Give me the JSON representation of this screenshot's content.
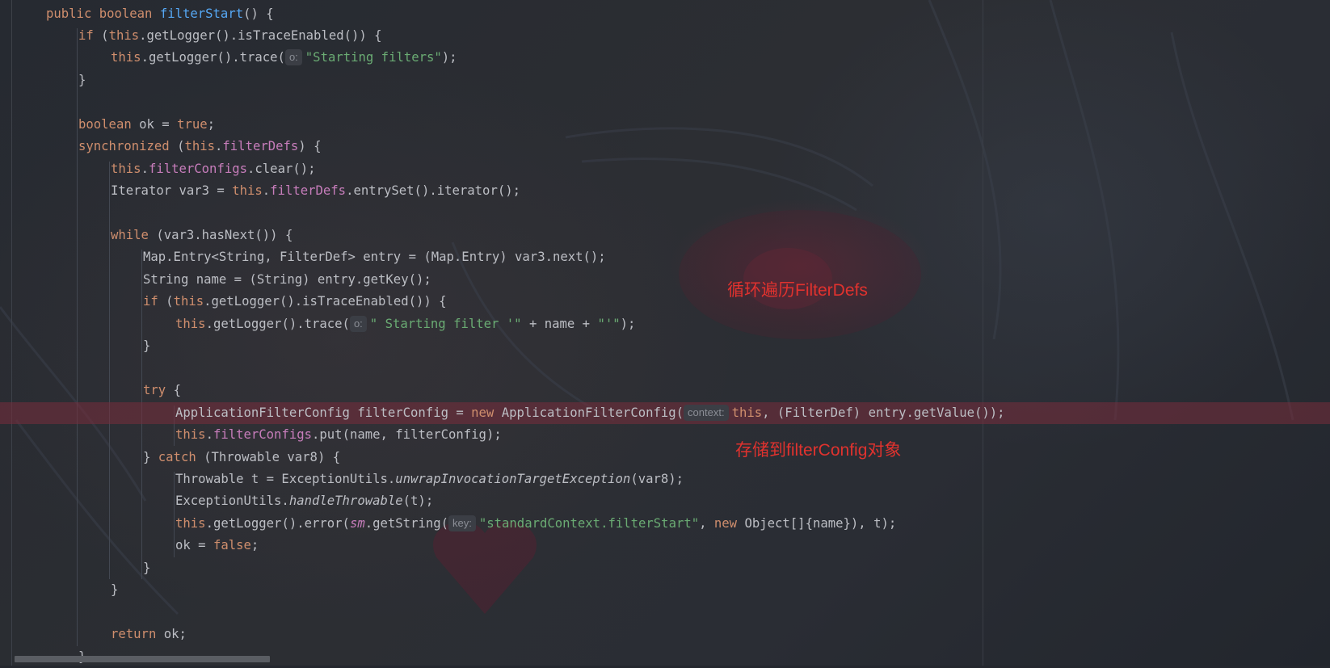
{
  "editor": {
    "lines": [
      {
        "segs": [
          {
            "t": "public boolean ",
            "c": "kw"
          },
          {
            "t": "filterStart",
            "c": "fn"
          },
          {
            "t": "() {",
            "c": ""
          }
        ]
      },
      {
        "segs": [
          {
            "t": "if ",
            "c": "kw"
          },
          {
            "t": "(",
            "c": ""
          },
          {
            "t": "this",
            "c": "kw"
          },
          {
            "t": ".getLogger().isTraceEnabled()) {",
            "c": ""
          }
        ]
      },
      {
        "segs": [
          {
            "t": "this",
            "c": "kw"
          },
          {
            "t": ".getLogger().trace(",
            "c": ""
          },
          {
            "hint": "o:"
          },
          {
            "t": "\"Starting filters\"",
            "c": "str"
          },
          {
            "t": ");",
            "c": ""
          }
        ]
      },
      {
        "segs": [
          {
            "t": "}",
            "c": ""
          }
        ]
      },
      {
        "segs": []
      },
      {
        "segs": [
          {
            "t": "boolean ",
            "c": "kw"
          },
          {
            "t": "ok = ",
            "c": ""
          },
          {
            "t": "true",
            "c": "kw"
          },
          {
            "t": ";",
            "c": ""
          }
        ]
      },
      {
        "segs": [
          {
            "t": "synchronized ",
            "c": "kw"
          },
          {
            "t": "(",
            "c": ""
          },
          {
            "t": "this",
            "c": "kw"
          },
          {
            "t": ".",
            "c": ""
          },
          {
            "t": "filterDefs",
            "c": "fld"
          },
          {
            "t": ") {",
            "c": ""
          }
        ]
      },
      {
        "segs": [
          {
            "t": "this",
            "c": "kw"
          },
          {
            "t": ".",
            "c": ""
          },
          {
            "t": "filterConfigs",
            "c": "fld"
          },
          {
            "t": ".clear();",
            "c": ""
          }
        ]
      },
      {
        "segs": [
          {
            "t": "Iterator var3 = ",
            "c": ""
          },
          {
            "t": "this",
            "c": "kw"
          },
          {
            "t": ".",
            "c": ""
          },
          {
            "t": "filterDefs",
            "c": "fld"
          },
          {
            "t": ".entrySet().iterator();",
            "c": ""
          }
        ]
      },
      {
        "segs": []
      },
      {
        "segs": [
          {
            "t": "while ",
            "c": "kw"
          },
          {
            "t": "(var3.hasNext()) {",
            "c": ""
          }
        ]
      },
      {
        "segs": [
          {
            "t": "Map.Entry<String, FilterDef> entry = (Map.Entry) var3.next();",
            "c": ""
          }
        ]
      },
      {
        "segs": [
          {
            "t": "String name = (String) entry.getKey();",
            "c": ""
          }
        ]
      },
      {
        "segs": [
          {
            "t": "if ",
            "c": "kw"
          },
          {
            "t": "(",
            "c": ""
          },
          {
            "t": "this",
            "c": "kw"
          },
          {
            "t": ".getLogger().isTraceEnabled()) {",
            "c": ""
          }
        ]
      },
      {
        "segs": [
          {
            "t": "this",
            "c": "kw"
          },
          {
            "t": ".getLogger().trace(",
            "c": ""
          },
          {
            "hint": "o:"
          },
          {
            "t": "\" Starting filter '\"",
            "c": "str"
          },
          {
            "t": " + name + ",
            "c": ""
          },
          {
            "t": "\"'\"",
            "c": "str"
          },
          {
            "t": ");",
            "c": ""
          }
        ]
      },
      {
        "segs": [
          {
            "t": "}",
            "c": ""
          }
        ]
      },
      {
        "segs": []
      },
      {
        "segs": [
          {
            "t": "try ",
            "c": "kw"
          },
          {
            "t": "{",
            "c": ""
          }
        ]
      },
      {
        "segs": [
          {
            "t": "ApplicationFilterConfig filterConfig = ",
            "c": ""
          },
          {
            "t": "new ",
            "c": "kw"
          },
          {
            "t": "ApplicationFilterConfig(",
            "c": ""
          },
          {
            "hint": "context:"
          },
          {
            "t": "this",
            "c": "kw"
          },
          {
            "t": ", (FilterDef) entry.getValue());",
            "c": ""
          }
        ]
      },
      {
        "segs": [
          {
            "t": "this",
            "c": "kw"
          },
          {
            "t": ".",
            "c": ""
          },
          {
            "t": "filterConfigs",
            "c": "fld"
          },
          {
            "t": ".put(name, filterConfig);",
            "c": ""
          }
        ]
      },
      {
        "segs": [
          {
            "t": "} ",
            "c": ""
          },
          {
            "t": "catch ",
            "c": "kw"
          },
          {
            "t": "(Throwable var8) {",
            "c": ""
          }
        ]
      },
      {
        "segs": [
          {
            "t": "Throwable t = ExceptionUtils.",
            "c": ""
          },
          {
            "t": "unwrapInvocationTargetException",
            "c": "it"
          },
          {
            "t": "(var8);",
            "c": ""
          }
        ]
      },
      {
        "segs": [
          {
            "t": "ExceptionUtils.",
            "c": ""
          },
          {
            "t": "handleThrowable",
            "c": "it"
          },
          {
            "t": "(t);",
            "c": ""
          }
        ]
      },
      {
        "segs": [
          {
            "t": "this",
            "c": "kw"
          },
          {
            "t": ".getLogger().error(",
            "c": ""
          },
          {
            "t": "sm",
            "c": "stat"
          },
          {
            "t": ".getString(",
            "c": ""
          },
          {
            "hint": "key:"
          },
          {
            "t": "\"standardContext.filterStart\"",
            "c": "str"
          },
          {
            "t": ", ",
            "c": ""
          },
          {
            "t": "new ",
            "c": "kw"
          },
          {
            "t": "Object[]{name}), t);",
            "c": ""
          }
        ]
      },
      {
        "segs": [
          {
            "t": "ok = ",
            "c": ""
          },
          {
            "t": "false",
            "c": "kw"
          },
          {
            "t": ";",
            "c": ""
          }
        ]
      },
      {
        "segs": [
          {
            "t": "}",
            "c": ""
          }
        ]
      },
      {
        "segs": [
          {
            "t": "}",
            "c": ""
          }
        ]
      },
      {
        "segs": []
      },
      {
        "segs": [
          {
            "t": "return ",
            "c": "kw"
          },
          {
            "t": "ok;",
            "c": ""
          }
        ]
      },
      {
        "segs": [
          {
            "t": "}",
            "c": ""
          }
        ]
      }
    ]
  },
  "annotations": {
    "loop_note": "循环遍历FilterDefs",
    "store_note": "存储到filterConfig对象"
  },
  "colors": {
    "keyword": "#cf8e6d",
    "method": "#56a8f5",
    "field": "#c77dbb",
    "string": "#6aab73",
    "text": "#bcbec4",
    "annotation": "#e0322e",
    "highlight": "#5a2a36"
  }
}
